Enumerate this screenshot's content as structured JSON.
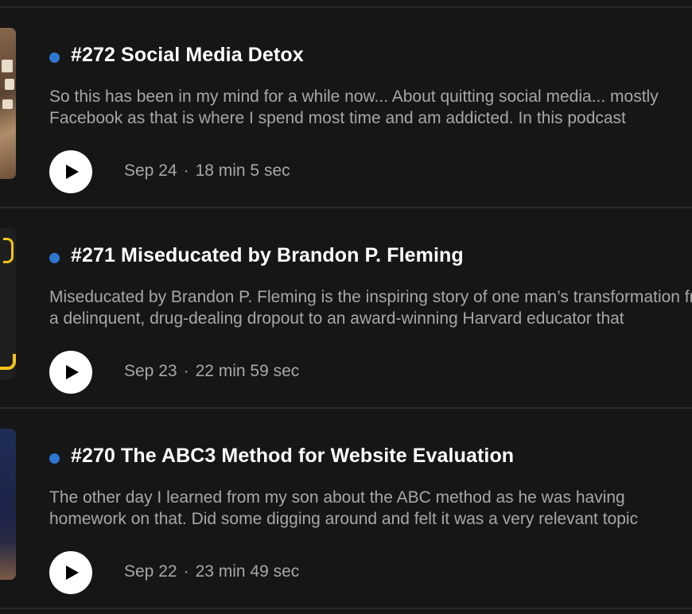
{
  "episodes": [
    {
      "title": "#272 Social Media Detox",
      "description_line1": "So this has been in my mind for a while now... About quitting social media... mostly",
      "description_line2": "Facebook as that is where I spend most time and am addicted. In this podcast",
      "date": "Sep 24",
      "separator": "·",
      "duration": "18 min 5 sec"
    },
    {
      "title": "#271 Miseducated by Brandon P. Fleming",
      "description_line1": "Miseducated by Brandon P. Fleming is the inspiring story of one man’s transformation from",
      "description_line2": "a delinquent, drug-dealing dropout to an award-winning Harvard educator that",
      "date": "Sep 23",
      "separator": "·",
      "duration": "22 min 59 sec"
    },
    {
      "title": "#270 The ABC3 Method for Website Evaluation",
      "description_line1": "The other day I learned from my son about the ABC method as he was having",
      "description_line2": "homework on that. Did some digging around and felt it was a very relevant topic",
      "date": "Sep 22",
      "separator": "·",
      "duration": "23 min 49 sec"
    }
  ],
  "colors": {
    "background": "#161616",
    "new_dot": "#2e77d0",
    "title": "#ffffff",
    "secondary_text": "#a7a7a7",
    "play_button": "#ffffff"
  },
  "icons": {
    "play": "play-icon",
    "new_indicator": "new-episode-dot"
  }
}
